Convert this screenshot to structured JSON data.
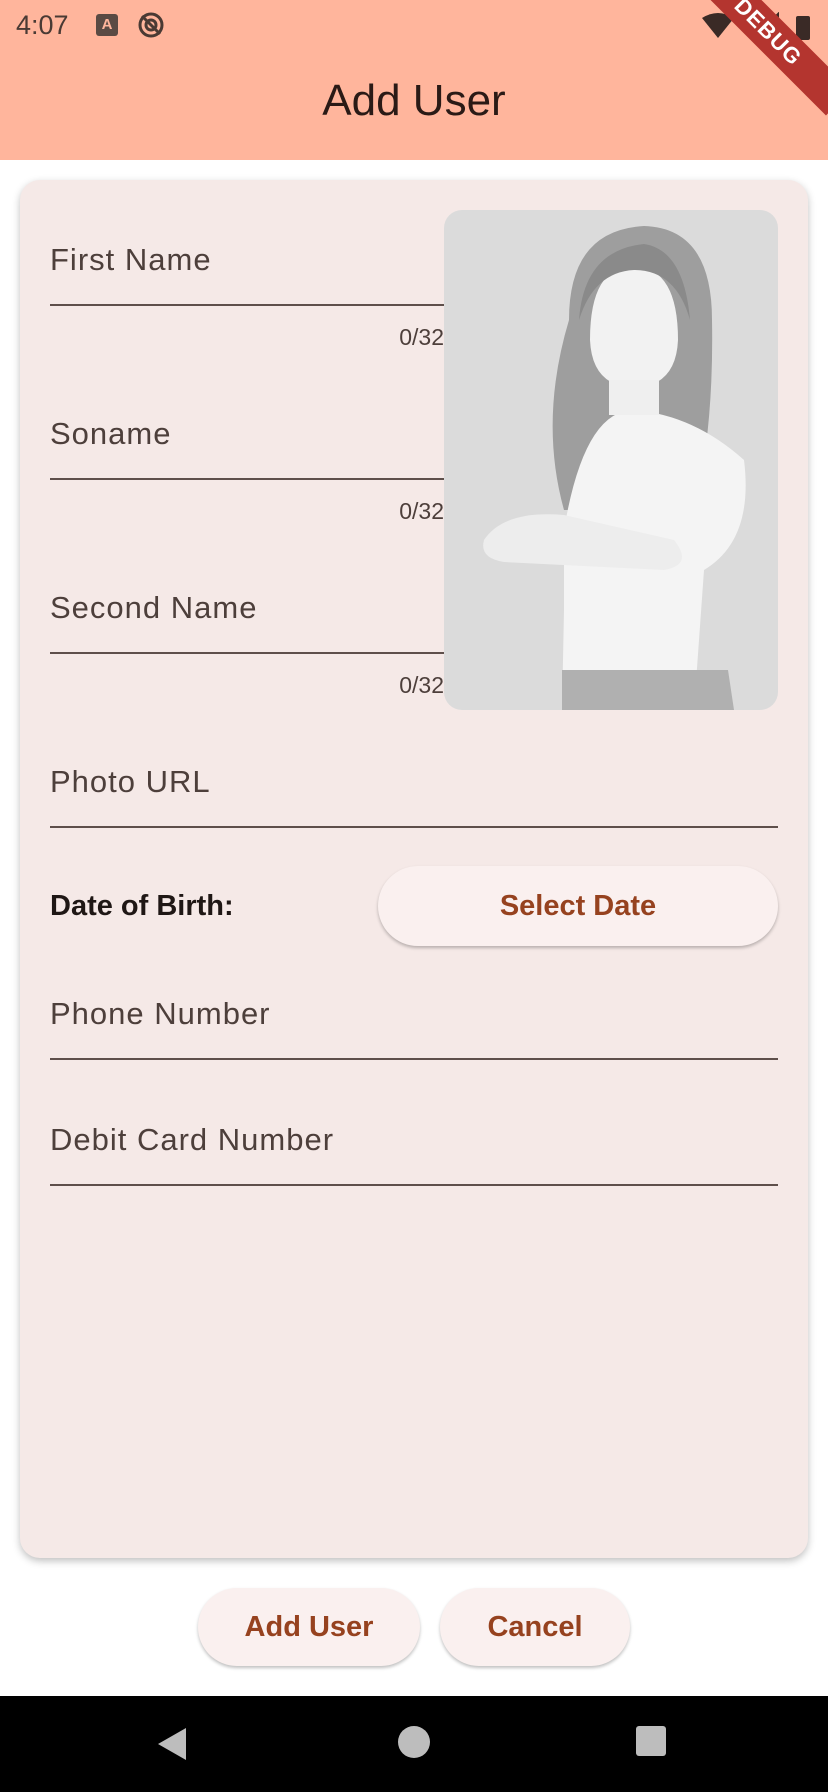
{
  "status_bar": {
    "time": "4:07",
    "debug_banner": "DEBUG"
  },
  "app_bar": {
    "title": "Add User"
  },
  "form": {
    "first_name": {
      "label": "First Name",
      "value": "",
      "counter": "0/32"
    },
    "soname": {
      "label": "Soname",
      "value": "",
      "counter": "0/32"
    },
    "second_name": {
      "label": "Second Name",
      "value": "",
      "counter": "0/32"
    },
    "photo_url": {
      "label": "Photo URL",
      "value": ""
    },
    "date_of_birth": {
      "label": "Date of Birth:",
      "button_label": "Select Date"
    },
    "phone_number": {
      "label": "Phone Number",
      "value": ""
    },
    "debit_card": {
      "label": "Debit Card Number",
      "value": ""
    }
  },
  "photo": {
    "icon": "user-placeholder-photo"
  },
  "actions": {
    "add_user": "Add User",
    "cancel": "Cancel"
  },
  "colors": {
    "app_bar": "#FFB59C",
    "card_background": "#F5E9E7",
    "button_background": "#FAF0EF",
    "button_text": "#96421F",
    "debug_ribbon": "#B4352F"
  }
}
